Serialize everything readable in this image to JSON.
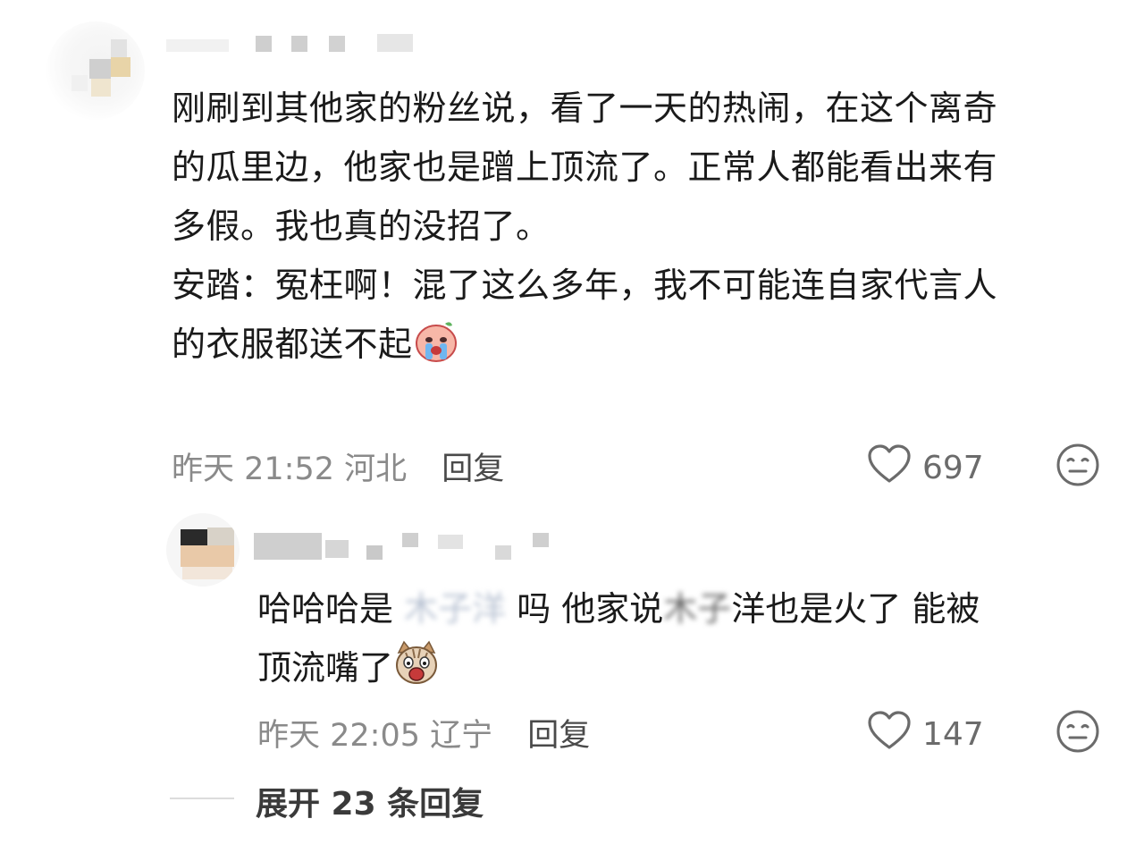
{
  "comment": {
    "author_masked": "",
    "lines": [
      "刚刷到其他家的粉丝说，看了一天的热闹，在这个离奇",
      "的瓜里边，他家也是蹭上顶流了。正常人都能看出来有",
      "多假。我也真的没招了。",
      "安踏：冤枉啊！混了这么多年，我不可能连自家代言人",
      "的衣服都送不起"
    ],
    "emoji_name": "crying-face-emoji",
    "time": "昨天 21:52",
    "location": "河北",
    "reply_label": "回复",
    "like_count": "697"
  },
  "reply": {
    "author_masked": "",
    "line1_a": "哈哈哈是 ",
    "line1_blur": "木子洋",
    "line1_b": " 吗 他家说",
    "line1_blur2": "木子",
    "line1_c": "洋也是火了 能被",
    "line2": "顶流嘴了",
    "emoji_name": "shocked-cat-emoji",
    "time": "昨天 22:05",
    "location": "辽宁",
    "reply_label": "回复",
    "like_count": "147"
  },
  "expand": {
    "label": "展开 23 条回复"
  },
  "colors": {
    "text": "#1a1a1a",
    "meta": "#8a8a8a",
    "icon": "#6b6b6b",
    "background": "#ffffff"
  }
}
